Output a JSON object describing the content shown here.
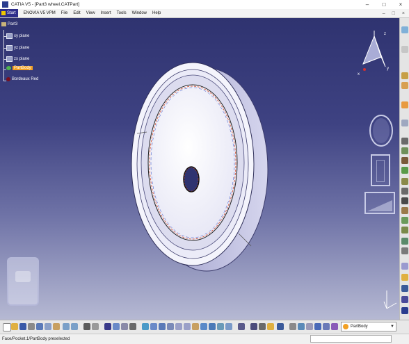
{
  "window": {
    "title": "CATIA V5 - [Part3 wheel.CATPart]",
    "controls": [
      "–",
      "□",
      "×"
    ]
  },
  "menu": {
    "start": "Start",
    "items": [
      "ENOVIA V5 VPM",
      "File",
      "Edit",
      "View",
      "Insert",
      "Tools",
      "Window",
      "Help"
    ],
    "right_controls": [
      "–",
      "□",
      "×"
    ]
  },
  "tree": {
    "root": "Part3",
    "items": [
      {
        "label": "xy plane",
        "icon": "plane-icon"
      },
      {
        "label": "yz plane",
        "icon": "plane-icon"
      },
      {
        "label": "zx plane",
        "icon": "plane-icon"
      },
      {
        "label": "PartBody",
        "icon": "partbody-icon",
        "selected": true
      },
      {
        "label": "Bordeaux Red",
        "icon": "material-icon"
      }
    ]
  },
  "compass": {
    "axes": [
      "z",
      "y",
      "x"
    ]
  },
  "part_body_selector": {
    "value": "PartBody"
  },
  "status": {
    "text": "Face/Pocket.1/PartBody preselected"
  },
  "colors": {
    "background_top": "#2f3370",
    "background_bottom": "#b6b9d3",
    "selection": "#f2a024",
    "tree_text": "#ffffff"
  }
}
